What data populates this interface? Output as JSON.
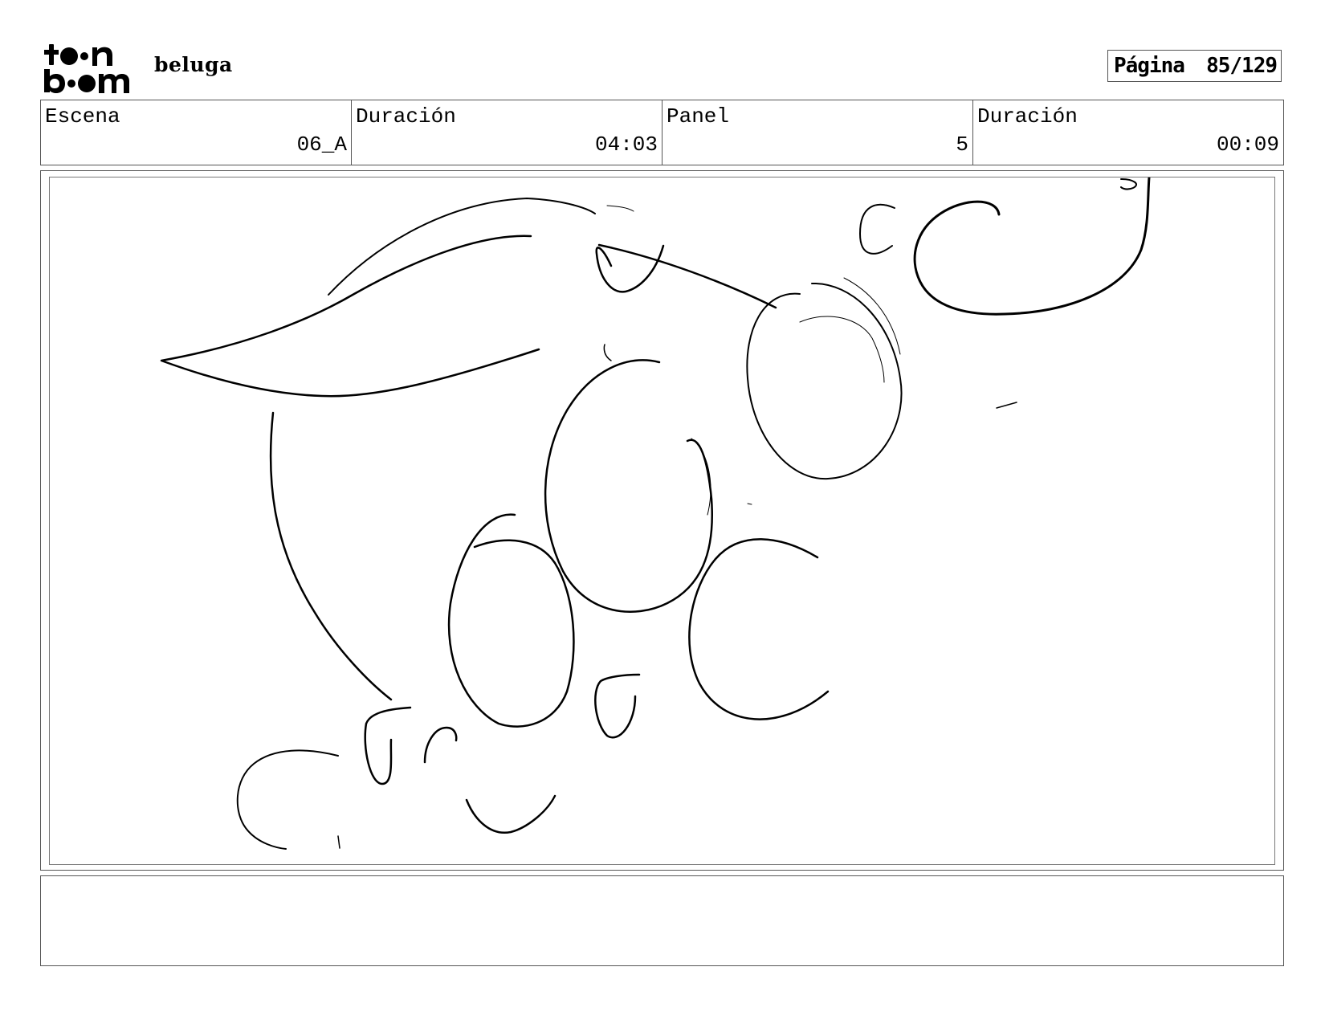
{
  "header": {
    "logo_text": "toon boom",
    "project_title": "beluga",
    "page_label": "Página",
    "page_number": "85/129"
  },
  "info": {
    "scene_label": "Escena",
    "scene_value": "06_A",
    "scene_duration_label": "Duración",
    "scene_duration_value": "04:03",
    "panel_label": "Panel",
    "panel_value": "5",
    "panel_duration_label": "Duración",
    "panel_duration_value": "00:09"
  },
  "panel_drawing": {
    "description_icon": "sketch-drawing",
    "stroke_color": "#000000"
  },
  "notes": {
    "text": ""
  }
}
